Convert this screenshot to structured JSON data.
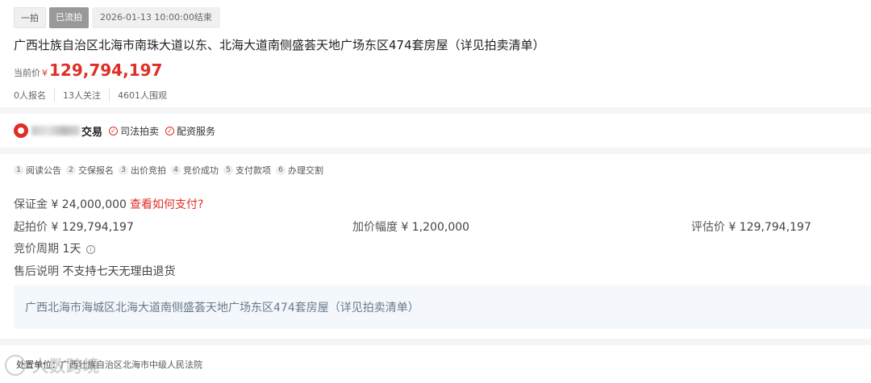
{
  "header": {
    "tag_type": "一拍",
    "tag_status": "已流拍",
    "end_time": "2026-01-13 10:00:00结束",
    "title": "广西壮族自治区北海市南珠大道以东、北海大道南侧盛荟天地广场东区474套房屋（详见拍卖清单）",
    "price_label": "当前价",
    "currency": "¥",
    "current_price": "129,794,197",
    "stats": [
      "0人报名",
      "13人关注",
      "4601人围观"
    ]
  },
  "org": {
    "name_suffix": "交易",
    "badges": [
      "司法拍卖",
      "配资服务"
    ]
  },
  "steps": [
    {
      "num": "1",
      "label": "阅读公告"
    },
    {
      "num": "2",
      "label": "交保报名"
    },
    {
      "num": "3",
      "label": "出价竞拍"
    },
    {
      "num": "4",
      "label": "竞价成功"
    },
    {
      "num": "5",
      "label": "支付款项"
    },
    {
      "num": "6",
      "label": "办理交割"
    }
  ],
  "details": {
    "deposit_label": "保证金",
    "deposit_value": "¥ 24,000,000",
    "deposit_link": "查看如何支付?",
    "start_price_label": "起拍价",
    "start_price_value": "¥ 129,794,197",
    "increment_label": "加价幅度",
    "increment_value": "¥ 1,200,000",
    "appraisal_label": "评估价",
    "appraisal_value": "¥ 129,794,197",
    "cycle_label": "竞价周期",
    "cycle_value": "1天",
    "aftersale_label": "售后说明",
    "aftersale_value": "不支持七天无理由退货",
    "address": "广西北海市海城区北海大道南侧盛荟天地广场东区474套房屋（详见拍卖清单）"
  },
  "court": {
    "label": "处置单位：",
    "value": "广西壮族自治区北海市中级人民法院",
    "watermark": "大数跨境"
  },
  "colors": {
    "accent": "#e02e24",
    "address_bg": "#f4f7fb"
  }
}
